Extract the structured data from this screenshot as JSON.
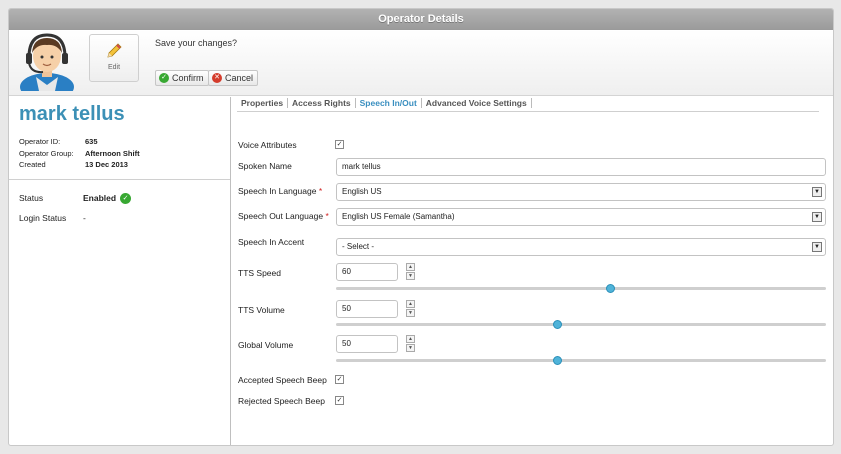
{
  "window": {
    "title": "Operator Details"
  },
  "toolbar": {
    "edit_label": "Edit",
    "save_question": "Save your changes?",
    "confirm_label": "Confirm",
    "cancel_label": "Cancel"
  },
  "operator": {
    "name": "mark tellus",
    "id_label": "Operator ID:",
    "id_value": "635",
    "group_label": "Operator Group:",
    "group_value": "Afternoon Shift",
    "created_label": "Created",
    "created_value": "13 Dec 2013",
    "status_label": "Status",
    "status_value": "Enabled",
    "login_status_label": "Login Status",
    "login_status_value": "-"
  },
  "tabs": [
    {
      "label": "Properties",
      "active": false
    },
    {
      "label": "Access Rights",
      "active": false
    },
    {
      "label": "Speech In/Out",
      "active": true
    },
    {
      "label": "Advanced Voice Settings",
      "active": false
    }
  ],
  "form": {
    "voice_attributes": {
      "label": "Voice Attributes",
      "checked": true
    },
    "spoken_name": {
      "label": "Spoken Name",
      "value": "mark tellus"
    },
    "speech_in_language": {
      "label": "Speech In Language",
      "required": "*",
      "value": "English US"
    },
    "speech_out_language": {
      "label": "Speech Out Language",
      "required": "*",
      "value": "English US Female (Samantha)"
    },
    "speech_in_accent": {
      "label": "Speech In Accent",
      "value": "- Select -"
    },
    "tts_speed": {
      "label": "TTS Speed",
      "value": "60",
      "level": 0.56
    },
    "tts_volume": {
      "label": "TTS Volume",
      "value": "50",
      "level": 0.45
    },
    "global_volume": {
      "label": "Global Volume",
      "value": "50",
      "level": 0.45
    },
    "accepted_beep": {
      "label": "Accepted Speech Beep",
      "checked": true
    },
    "rejected_beep": {
      "label": "Rejected Speech Beep",
      "checked": true
    }
  },
  "colors": {
    "accent": "#3a8fc0",
    "name": "#3c90b6",
    "ok": "#38a832",
    "cancel": "#d43c2c",
    "slider": "#4fb3d9"
  },
  "icons": {
    "edit": "pencil-icon",
    "confirm": "check-circle-icon",
    "cancel": "x-circle-icon",
    "avatar": "operator-headset-avatar",
    "status": "check-circle-icon"
  }
}
